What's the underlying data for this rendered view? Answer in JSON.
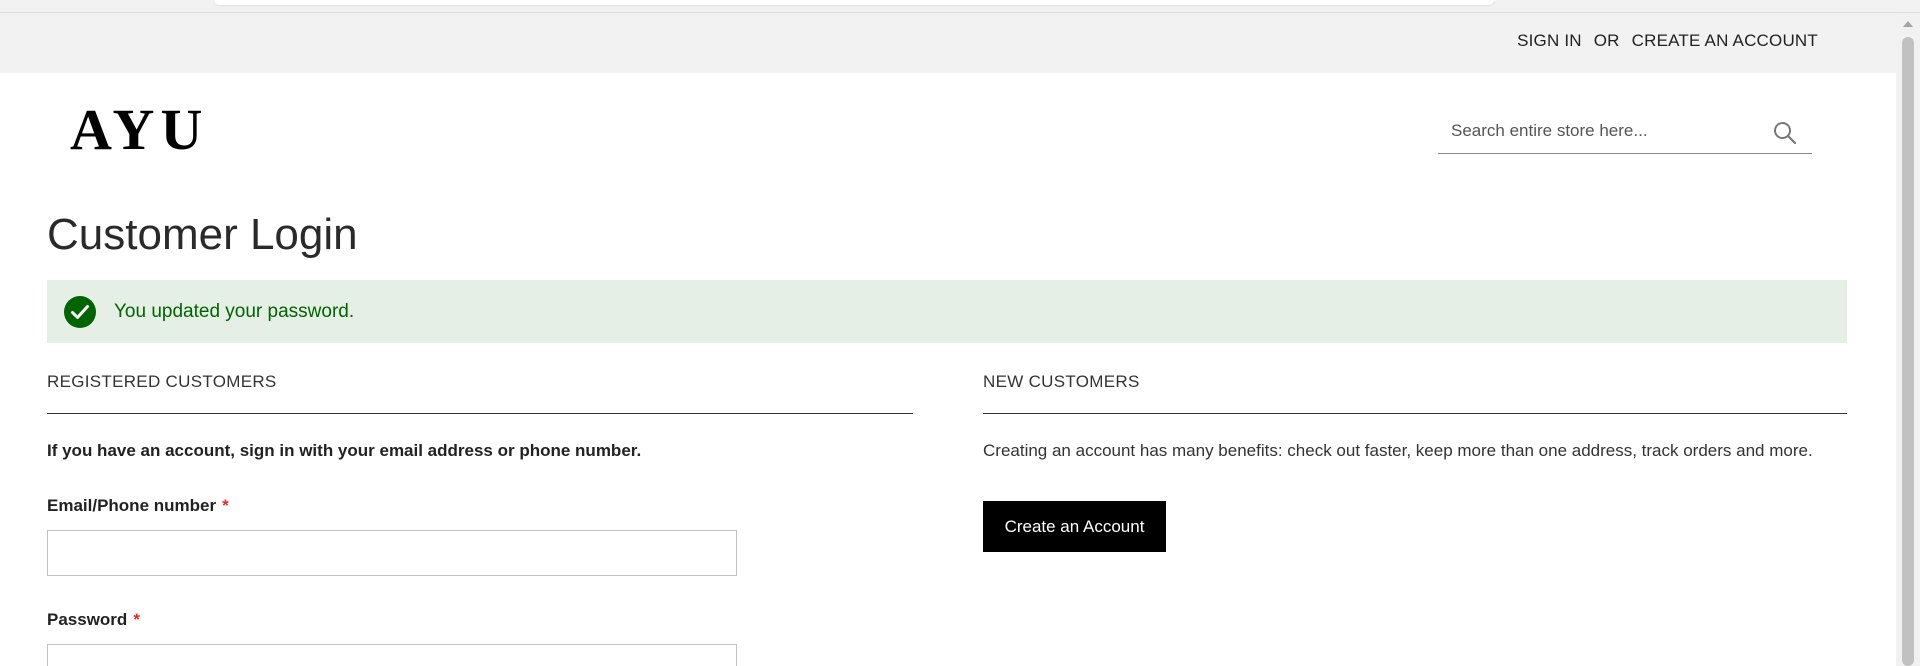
{
  "header": {
    "sign_in": "SIGN IN",
    "separator": "OR",
    "create_account": "CREATE AN ACCOUNT"
  },
  "logo": {
    "text": "AYU"
  },
  "search": {
    "placeholder": "Search entire store here...",
    "icon": "search-icon"
  },
  "page": {
    "title": "Customer Login"
  },
  "message": {
    "icon": "check-circle-icon",
    "text": "You updated your password."
  },
  "registered": {
    "title": "REGISTERED CUSTOMERS",
    "intro": "If you have an account, sign in with your email address or phone number.",
    "email_label": "Email/Phone number",
    "password_label": "Password",
    "required_mark": "*"
  },
  "new_customers": {
    "title": "NEW CUSTOMERS",
    "intro": "Creating an account has many benefits: check out faster, keep more than one address, track orders and more.",
    "create_button": "Create an Account"
  },
  "colors": {
    "message_bg": "#e5efe5",
    "message_text": "#006400",
    "required": "#e02b27",
    "button_bg": "#000000",
    "header_bg": "#f2f2f2"
  }
}
